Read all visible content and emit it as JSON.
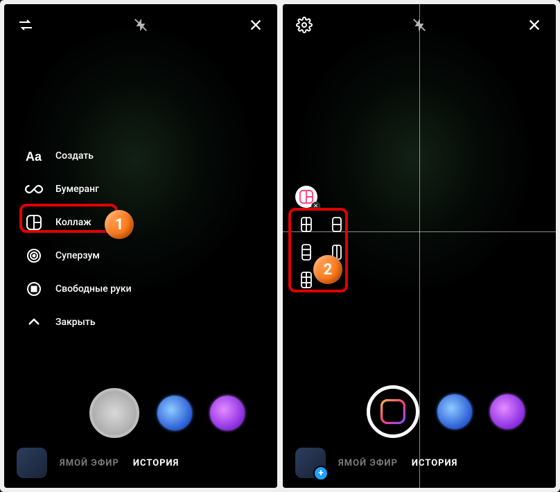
{
  "annotations": {
    "marker1": "1",
    "marker2": "2"
  },
  "left": {
    "modes": {
      "create": "Создать",
      "boomerang": "Бумеранг",
      "layout": "Коллаж",
      "superzoom": "Суперзум",
      "handsfree": "Свободные руки",
      "close": "Закрыть"
    },
    "nav": {
      "live": "ЯМОЙ ЭФИР",
      "story": "ИСТОРИЯ"
    }
  },
  "right": {
    "nav": {
      "live": "ЯМОЙ ЭФИР",
      "story": "ИСТОРИЯ"
    }
  }
}
